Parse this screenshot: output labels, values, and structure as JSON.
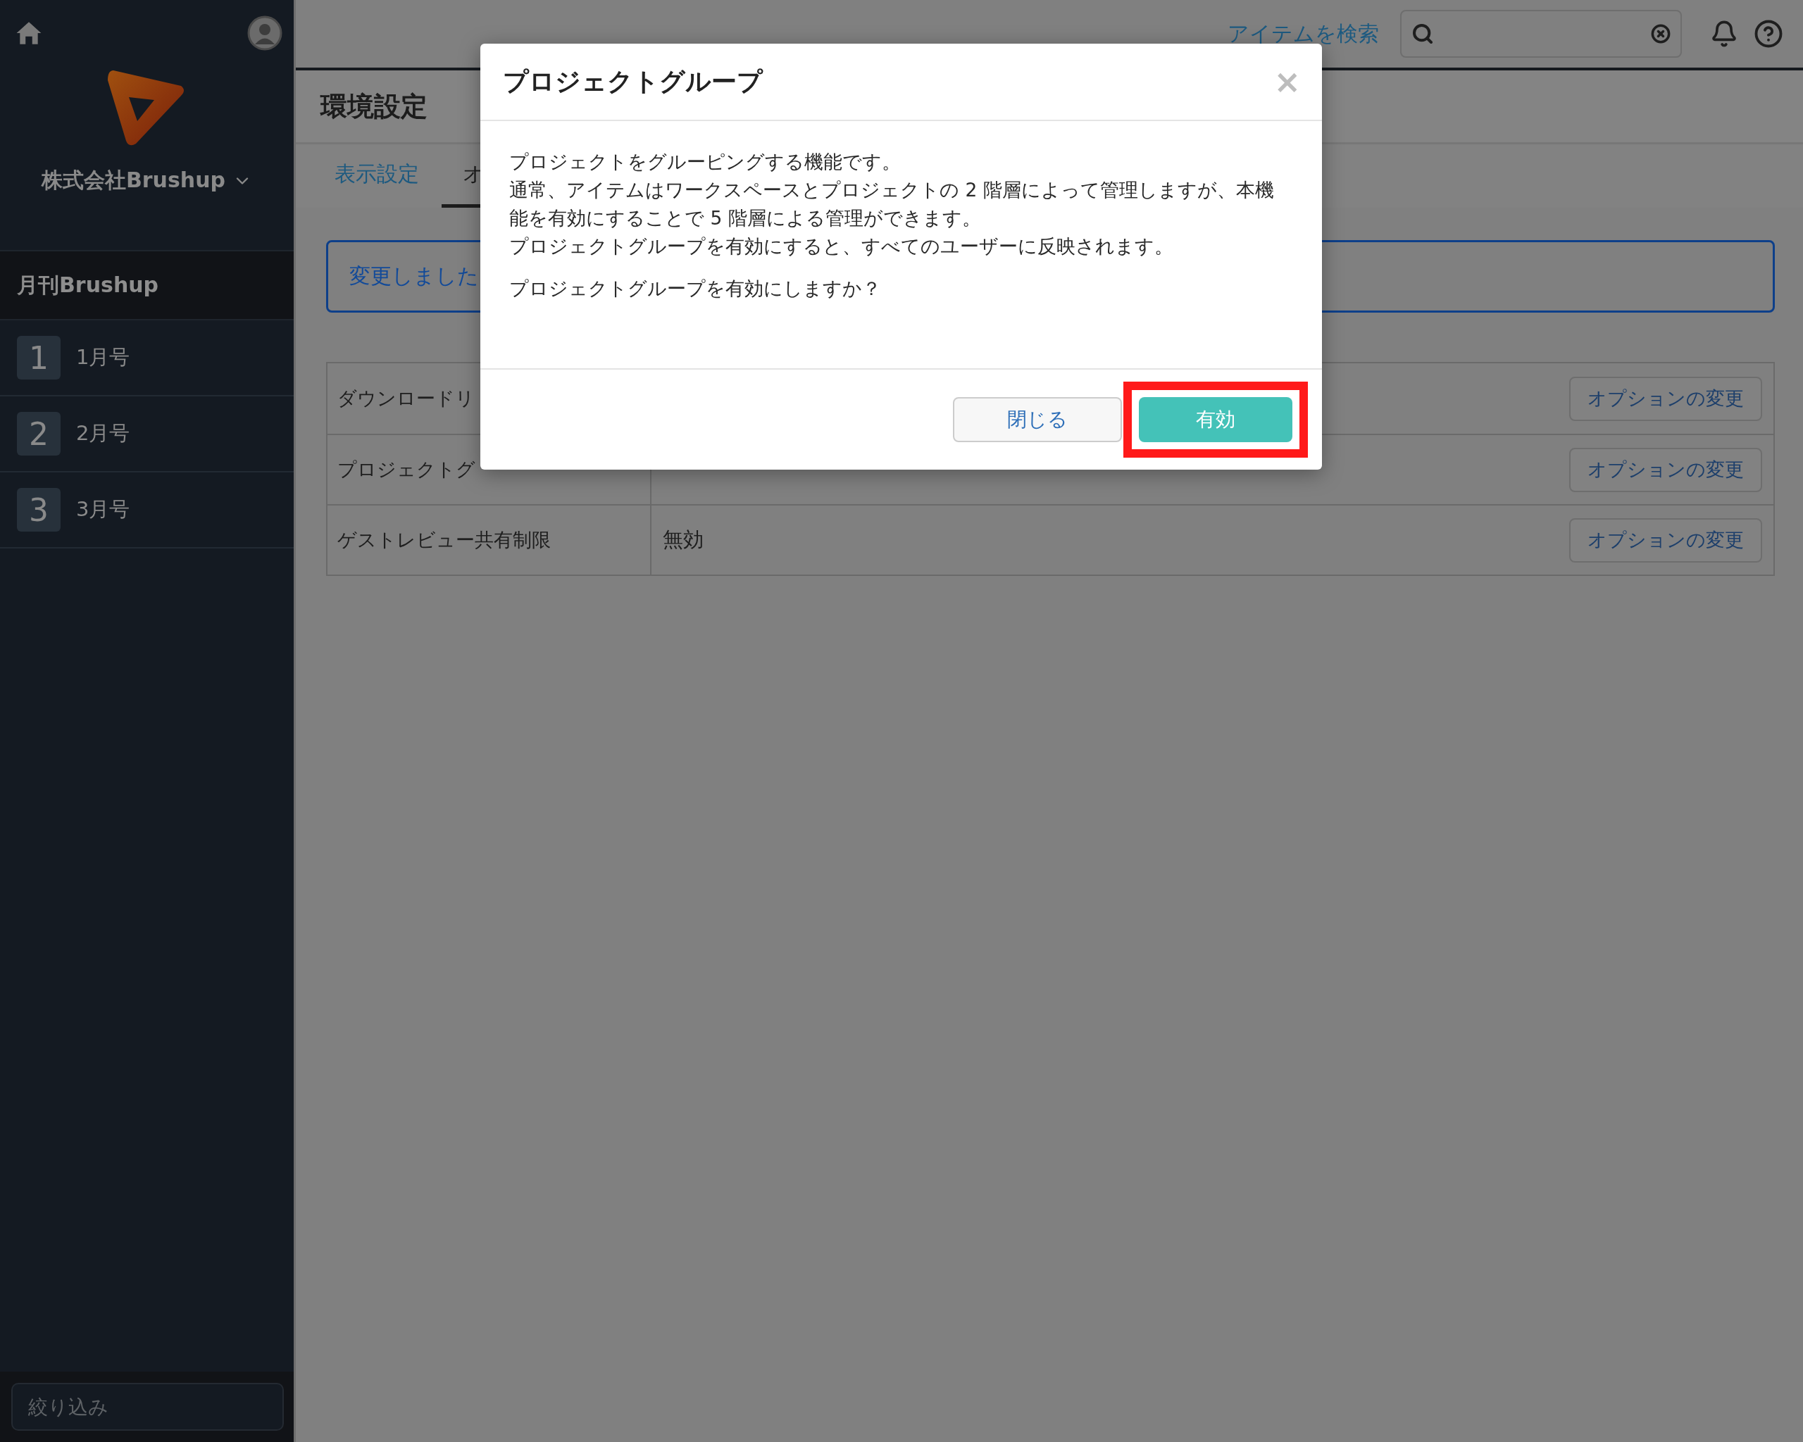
{
  "sidebar": {
    "company": "株式会社Brushup",
    "project": "月刊Brushup",
    "issues": [
      {
        "number": "1",
        "label": "1月号"
      },
      {
        "number": "2",
        "label": "2月号"
      },
      {
        "number": "3",
        "label": "3月号"
      }
    ],
    "filter": {
      "placeholder": "絞り込み"
    }
  },
  "topbar": {
    "search_link": "アイテムを検索"
  },
  "page": {
    "title": "環境設定",
    "tabs": [
      {
        "label": "表示設定",
        "selected": false
      },
      {
        "label": "オ",
        "selected": true
      }
    ],
    "alert": "変更しました",
    "options": [
      {
        "name": "ダウンロードリ",
        "button": "オプションの変更"
      },
      {
        "name": "プロジェクトグ",
        "button": "オプションの変更"
      },
      {
        "name": "ゲストレビュー共有制限",
        "value": "無効",
        "button": "オプションの変更"
      }
    ]
  },
  "dialog": {
    "title": "プロジェクトグループ",
    "close": "×",
    "lines": [
      "プロジェクトをグルーピングする機能です。",
      "通常、アイテムはワークスペースとプロジェクトの 2 階層によって管理しますが、本機能を有効にすることで 5 階層による管理ができます。",
      "プロジェクトグループを有効にすると、すべてのユーザーに反映されます。"
    ],
    "question": "プロジェクトグループを有効にしますか？",
    "buttons": [
      {
        "label": "閉じる",
        "kind": "secondary",
        "highlighted": false
      },
      {
        "label": "有効",
        "kind": "primary",
        "highlighted": true
      }
    ]
  }
}
